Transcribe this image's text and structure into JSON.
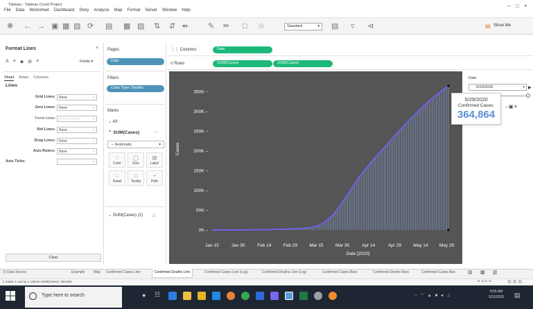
{
  "window": {
    "title": "Tableau - Tableau Covid Project",
    "menu": [
      "File",
      "Data",
      "Worksheet",
      "Dashboard",
      "Story",
      "Analysis",
      "Map",
      "Format",
      "Server",
      "Window",
      "Help"
    ]
  },
  "toolbar": {
    "standard": "Standard",
    "show_me": "Show Me"
  },
  "format_panel": {
    "title": "Format Lines",
    "fields_label": "Fields ▾",
    "tabs": [
      "Sheet",
      "Rows",
      "Columns"
    ],
    "section": "Lines",
    "props": [
      {
        "label": "Grid Lines:",
        "value": "None"
      },
      {
        "label": "Zero Lines:",
        "value": "None"
      },
      {
        "label": "Trend Lines:",
        "value": "- - - - - - - - - -"
      },
      {
        "label": "Ref Lines:",
        "value": "None"
      },
      {
        "label": "Drop Lines:",
        "value": "None"
      },
      {
        "label": "Axis Rulers:",
        "value": "None"
      },
      {
        "label": "Axis Ticks:",
        "value": ""
      }
    ],
    "clear_label": "Clear"
  },
  "pages": {
    "label": "Pages",
    "pill": "Date"
  },
  "filters": {
    "label": "Filters",
    "pill": "Case Type: Deaths"
  },
  "marks": {
    "label": "Marks",
    "all": "All",
    "sum": "SUM(Cases)",
    "auto": "Automatic",
    "cards": [
      "Color",
      "Size",
      "Label",
      "Detail",
      "Tooltip",
      "Path"
    ],
    "sum2": "SUM(Cases) (2)"
  },
  "shelves": {
    "columns_label": "Columns",
    "rows_label": "Rows",
    "columns_pill": "Date",
    "rows_pills": [
      "SUM(Cases)",
      "SUM(Cases)"
    ]
  },
  "date_filter": {
    "label": "Date",
    "value": "5/29/2020"
  },
  "tooltip": {
    "date": "5/29/2020",
    "label": "Confirmed Cases:",
    "value": "364,864"
  },
  "sheet_tabs": [
    "Data Source",
    "Example",
    "Map",
    "Confirmed Cases Line",
    "Confirmed Deaths Line",
    "Confirmed Cases Line (Log)",
    "Confirmed Deaths Line (Log)",
    "Confirmed Cases Bars",
    "Confirmed Deaths Bars",
    "Confirmed Cases Ban"
  ],
  "active_tab": "Confirmed Deaths Line",
  "status": "2 marks   1 row by 1 column   SUM(Cases): 364,864",
  "taskbar": {
    "search_placeholder": "Type here to search",
    "time": "8:55 AM",
    "date": "5/31/2020"
  },
  "colors": {
    "chart_bg": "#555555",
    "line": "#6d63e8",
    "bars": "#8aa6e0",
    "pill_green": "#1db87a",
    "pill_blue": "#4e94b8"
  },
  "chart_data": {
    "type": "line",
    "x_ticks": [
      "Jan 15",
      "Jan 30",
      "Feb 14",
      "Feb 29",
      "Mar 15",
      "Mar 30",
      "Apr 14",
      "Apr 29",
      "May 14",
      "May 29"
    ],
    "y_ticks": [
      "0K",
      "50K",
      "100K",
      "150K",
      "200K",
      "250K",
      "300K",
      "350K"
    ],
    "xlabel": "Date [2020]",
    "ylabel": "Cases",
    "ylim": [
      0,
      370000
    ],
    "x_day_range": [
      0,
      136
    ],
    "series": [
      {
        "x": [
          0,
          15,
          30,
          45,
          55,
          60,
          65,
          70,
          75,
          80,
          85,
          90,
          95,
          100,
          105,
          110,
          115,
          120,
          125,
          130,
          136
        ],
        "values": [
          0,
          100,
          900,
          2700,
          5000,
          9000,
          20000,
          40000,
          70000,
          103000,
          136000,
          163000,
          190000,
          213000,
          238000,
          262000,
          285000,
          307000,
          327000,
          345000,
          364864
        ]
      }
    ]
  }
}
